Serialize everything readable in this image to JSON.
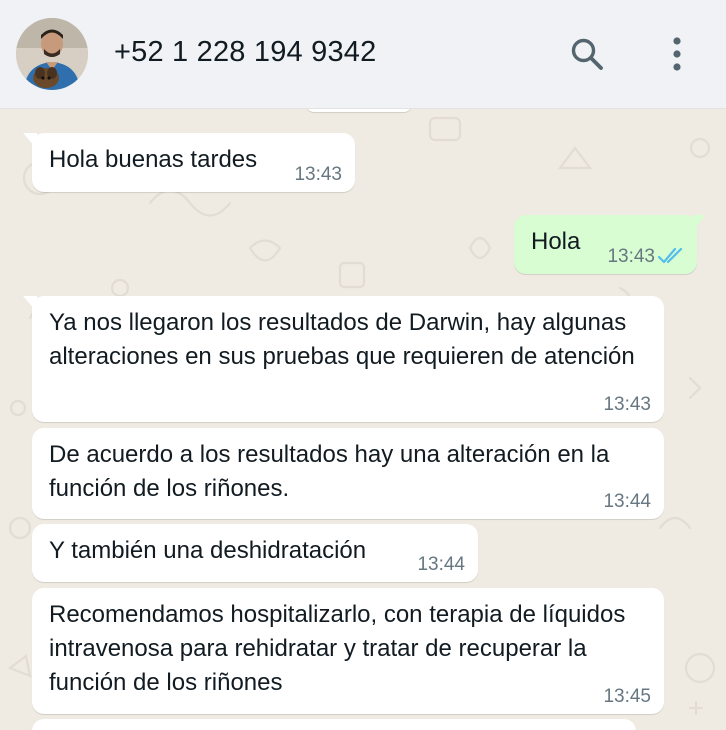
{
  "header": {
    "contact_name": "+52 1 228 194 9342",
    "avatar_icon": "avatar-photo",
    "search_icon": "search-icon",
    "menu_icon": "more-vertical-icon"
  },
  "colors": {
    "chat_background": "#efeae2",
    "incoming_bubble": "#ffffff",
    "outgoing_bubble": "#d9fdd3",
    "read_ticks": "#53bdeb",
    "header_background": "#f0f2f5"
  },
  "messages": [
    {
      "direction": "in",
      "text": "Hola buenas tardes",
      "time": "13:43"
    },
    {
      "direction": "out",
      "text": "Hola",
      "time": "13:43",
      "status": "read"
    },
    {
      "direction": "in",
      "text": "Ya nos llegaron los resultados de Darwin, hay algunas alteraciones en sus pruebas que requieren de atención",
      "time": "13:43"
    },
    {
      "direction": "in",
      "text": "De acuerdo a los resultados hay una alteración en la función de los riñones.",
      "time": "13:44"
    },
    {
      "direction": "in",
      "text": "Y también una deshidratación",
      "time": "13:44"
    },
    {
      "direction": "in",
      "text": "Recomendamos hospitalizarlo, con terapia de líquidos intravenosa para rehidratar y tratar de recuperar la función de los riñones",
      "time": "13:45"
    }
  ]
}
